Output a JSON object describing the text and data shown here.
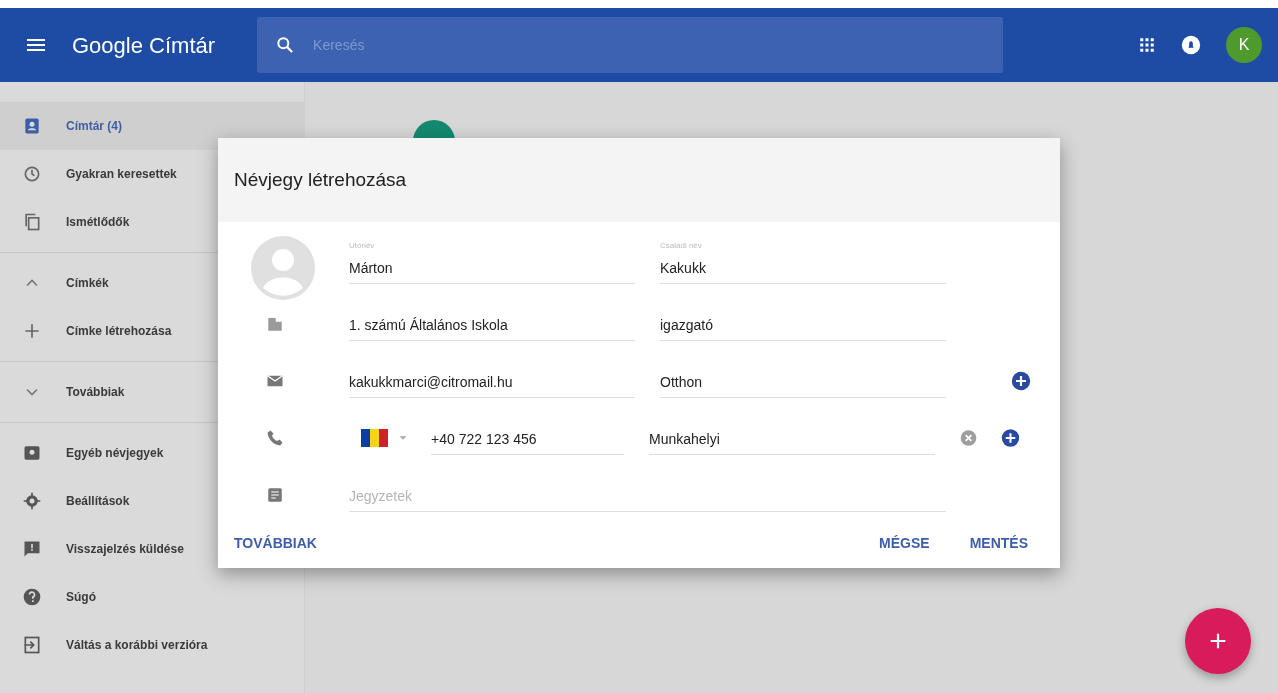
{
  "topbar": {
    "title": "Google Címtár",
    "search": {
      "placeholder": "Keresés"
    },
    "avatar": "K"
  },
  "sidebar": {
    "groups": [
      [
        {
          "kind": "item",
          "label": "Címtár (4)",
          "selected": true
        },
        {
          "kind": "item",
          "label": "Gyakran keresettek",
          "selected": false
        },
        {
          "kind": "item",
          "label": "Ismétlődők",
          "selected": false
        }
      ],
      [
        {
          "kind": "section",
          "label": "Címkék",
          "expanded": true
        },
        {
          "kind": "create",
          "label": "Címke létrehozása"
        }
      ],
      [
        {
          "kind": "section",
          "label": "Továbbiak",
          "expanded": false
        }
      ],
      [
        {
          "kind": "item",
          "label": "Egyéb névjegyek",
          "selected": false
        },
        {
          "kind": "item",
          "label": "Beállítások",
          "selected": false
        },
        {
          "kind": "item",
          "label": "Visszajelzés küldése",
          "selected": false
        },
        {
          "kind": "item",
          "label": "Súgó",
          "selected": false
        },
        {
          "kind": "item",
          "label": "Váltás a korábbi verzióra",
          "selected": false
        }
      ]
    ]
  },
  "dialog": {
    "title": "Névjegy létrehozása",
    "rows": [
      {
        "kind": "name",
        "fields": [
          {
            "label": "Utónév",
            "value": "Márton"
          },
          {
            "label": "Családi név",
            "value": "Kakukk"
          }
        ]
      },
      {
        "kind": "org",
        "fields": [
          {
            "value": "1. számú Általános Iskola"
          },
          {
            "value": "igazgató"
          }
        ]
      },
      {
        "kind": "email",
        "fields": [
          {
            "value": "kakukkmarci@citromail.hu"
          },
          {
            "value": "Otthon"
          }
        ],
        "actions": [
          {
            "kind": "add"
          }
        ]
      },
      {
        "kind": "phone",
        "fields": [
          {
            "value": "+40 722 123 456"
          },
          {
            "value": "Munkahelyi"
          }
        ],
        "actions": [
          {
            "kind": "remove"
          },
          {
            "kind": "add"
          }
        ]
      },
      {
        "kind": "notes",
        "fields": [
          {
            "placeholder": "Jegyzetek"
          }
        ]
      }
    ],
    "buttons": [
      "TOVÁBBIAK",
      "MÉGSE",
      "MENTÉS"
    ]
  }
}
